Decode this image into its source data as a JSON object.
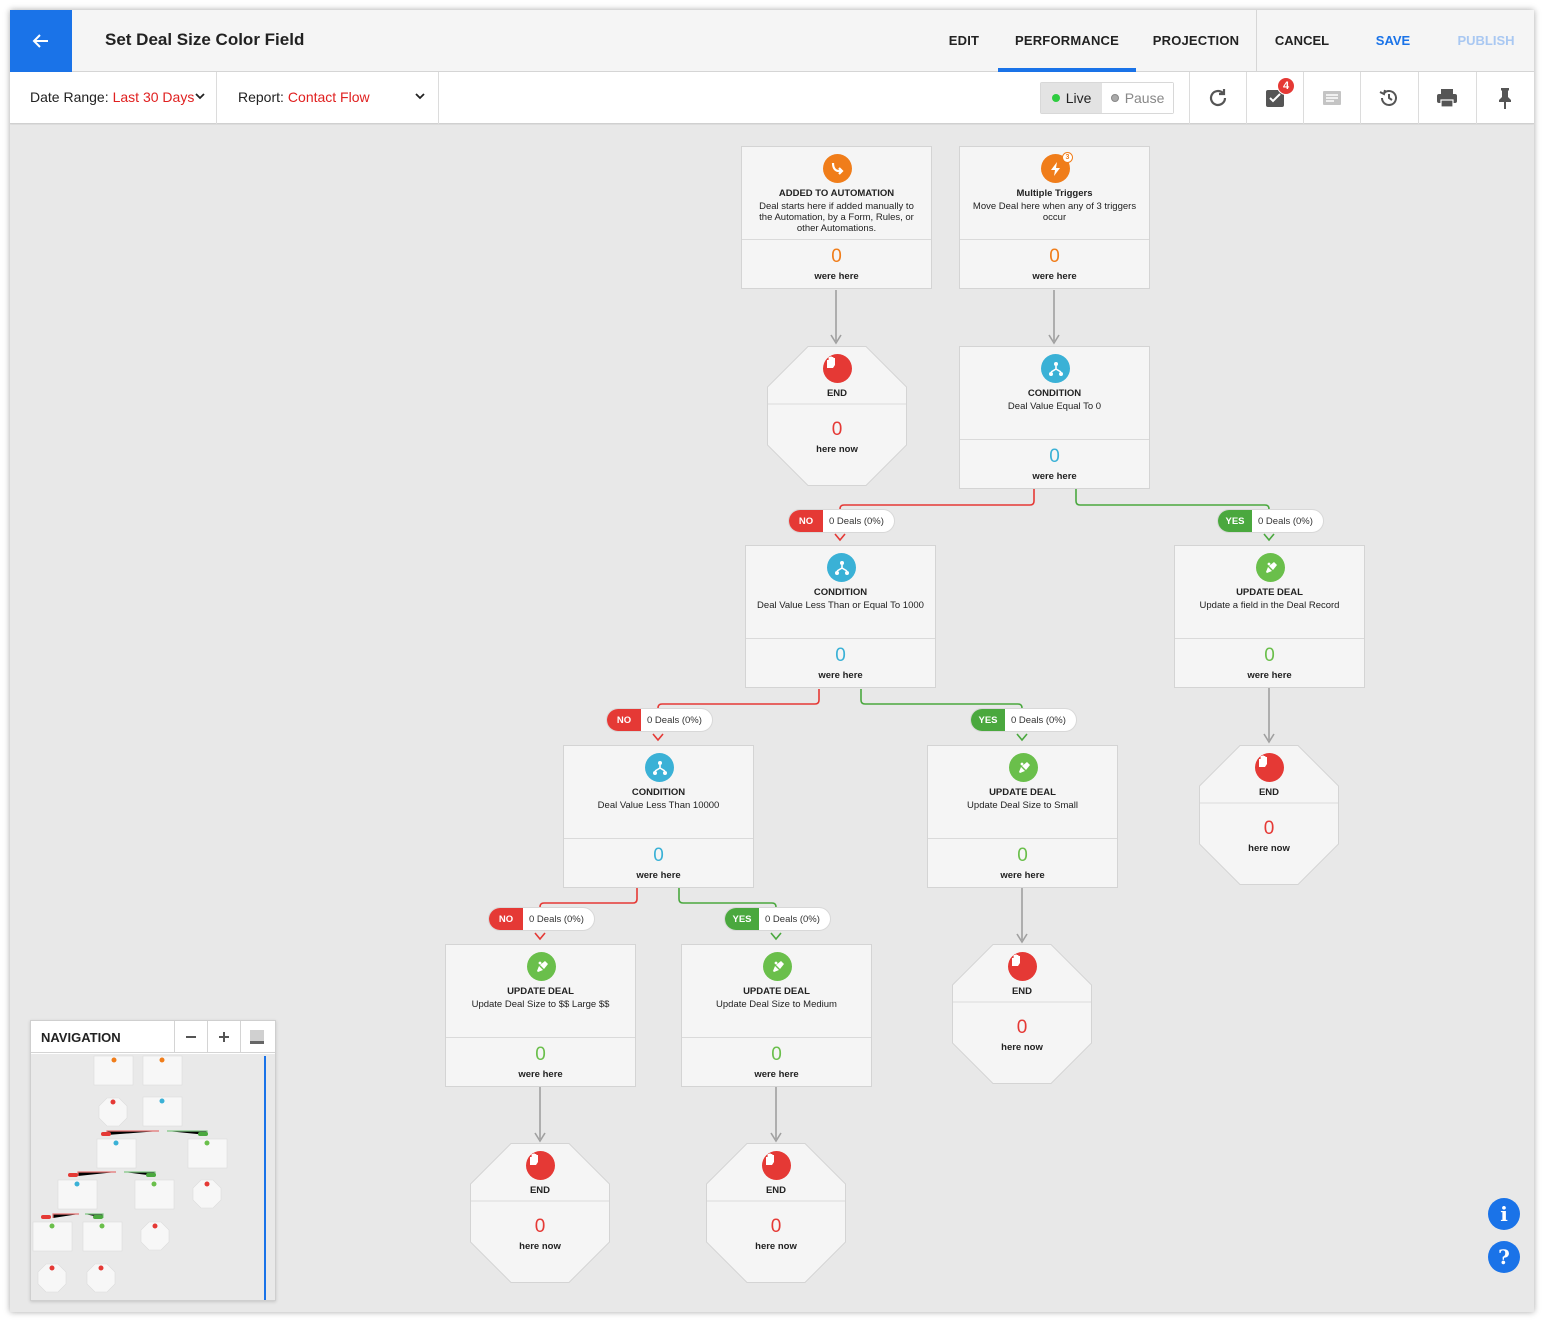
{
  "header": {
    "title": "Set Deal Size Color Field",
    "tabs": [
      {
        "label": "EDIT",
        "active": false
      },
      {
        "label": "PERFORMANCE",
        "active": true
      },
      {
        "label": "PROJECTION",
        "active": false
      }
    ],
    "actions": {
      "cancel": "CANCEL",
      "save": "SAVE",
      "publish": "PUBLISH"
    },
    "colors": {
      "accent": "#1a73e8",
      "publish_disabled": "#a9c8f2",
      "back_bg": "#1a73e8"
    }
  },
  "subbar": {
    "date_range_label": "Date Range:",
    "date_range_value": "Last 30 Days",
    "report_label": "Report:",
    "report_value": "Contact Flow",
    "live_label": "Live",
    "pause_label": "Pause",
    "tasks_badge": "4",
    "tools": [
      "refresh-icon",
      "tasks-icon",
      "notes-icon",
      "history-icon",
      "print-icon",
      "pin-icon"
    ]
  },
  "nodes": {
    "start": {
      "title": "ADDED TO AUTOMATION",
      "desc": "Deal starts here if added manually to the Automation, by a Form, Rules, or other Automations.",
      "count": "0",
      "label": "were here"
    },
    "triggers": {
      "title": "Multiple Triggers",
      "desc": "Move Deal here when any of 3 triggers occur",
      "badge": "3",
      "count": "0",
      "label": "were here"
    },
    "end1": {
      "title": "END",
      "count": "0",
      "label": "here now"
    },
    "cond1": {
      "title": "CONDITION",
      "desc": "Deal Value Equal To 0",
      "count": "0",
      "label": "were here"
    },
    "cond2": {
      "title": "CONDITION",
      "desc": "Deal Value Less Than or Equal To 1000",
      "count": "0",
      "label": "were here"
    },
    "upd_record": {
      "title": "UPDATE DEAL",
      "desc": "Update a field in the Deal Record",
      "count": "0",
      "label": "were here"
    },
    "cond3": {
      "title": "CONDITION",
      "desc": "Deal Value Less Than 10000",
      "count": "0",
      "label": "were here"
    },
    "upd_small": {
      "title": "UPDATE DEAL",
      "desc": "Update Deal Size to Small",
      "count": "0",
      "label": "were here"
    },
    "end_record": {
      "title": "END",
      "count": "0",
      "label": "here now"
    },
    "upd_large": {
      "title": "UPDATE DEAL",
      "desc": "Update Deal Size to $$ Large $$",
      "count": "0",
      "label": "were here"
    },
    "upd_medium": {
      "title": "UPDATE DEAL",
      "desc": "Update Deal Size to Medium",
      "count": "0",
      "label": "were here"
    },
    "end_small": {
      "title": "END",
      "count": "0",
      "label": "here now"
    },
    "end_large": {
      "title": "END",
      "count": "0",
      "label": "here now"
    },
    "end_medium": {
      "title": "END",
      "count": "0",
      "label": "here now"
    }
  },
  "branches": {
    "no1": {
      "tag": "NO",
      "text": "0 Deals (0%)"
    },
    "yes1": {
      "tag": "YES",
      "text": "0 Deals (0%)"
    },
    "no2": {
      "tag": "NO",
      "text": "0 Deals (0%)"
    },
    "yes2": {
      "tag": "YES",
      "text": "0 Deals (0%)"
    },
    "no3": {
      "tag": "NO",
      "text": "0 Deals (0%)"
    },
    "yes3": {
      "tag": "YES",
      "text": "0 Deals (0%)"
    }
  },
  "navigation": {
    "label": "NAVIGATION"
  },
  "colors": {
    "trigger_orange": "#f07d1a",
    "condition_blue": "#3ab1d6",
    "action_green": "#6abf4b",
    "end_red": "#e53935",
    "no_red": "#e53935",
    "yes_green": "#4aa83e",
    "wire_gray": "#a0a0a0"
  },
  "help": {
    "info_icon": "info-icon",
    "help_icon": "help-icon"
  }
}
